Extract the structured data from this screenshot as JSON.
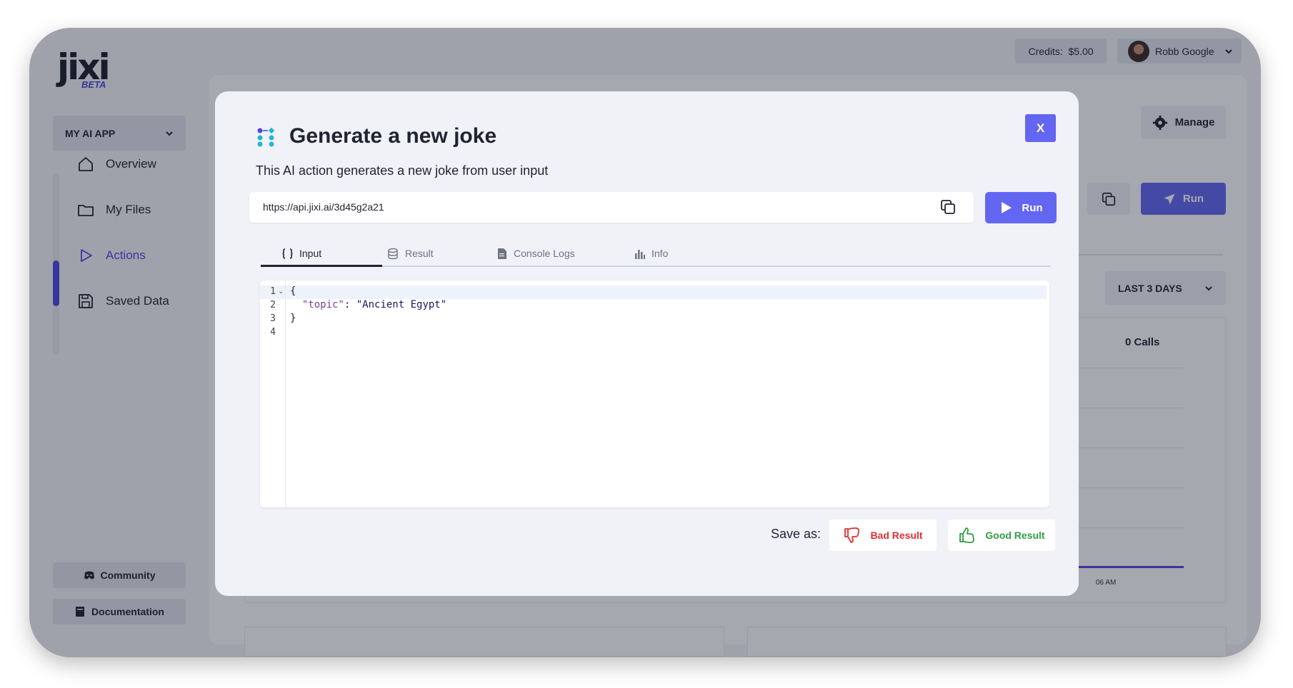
{
  "app": {
    "logo": "jixi",
    "logo_badge": "BETA",
    "app_select": "MY AI APP"
  },
  "header": {
    "credits_label": "Credits:",
    "credits_value": "$5.00",
    "user_name": "Robb Google"
  },
  "sidebar": {
    "items": [
      {
        "label": "Overview",
        "icon": "home-icon"
      },
      {
        "label": "My Files",
        "icon": "folder-icon"
      },
      {
        "label": "Actions",
        "icon": "play-icon",
        "active": true
      },
      {
        "label": "Saved Data",
        "icon": "save-icon"
      }
    ],
    "community": "Community",
    "documentation": "Documentation"
  },
  "background": {
    "manage": "Manage",
    "run": "Run",
    "range": "LAST 3 DAYS",
    "calls": "0 Calls",
    "tick": "06 AM"
  },
  "modal": {
    "title": "Generate a new joke",
    "description": "This AI action generates a new joke from user input",
    "close": "X",
    "url": "https://api.jixi.ai/3d45g2a21",
    "run": "Run",
    "tabs": [
      {
        "label": "Input",
        "icon": "braces-icon",
        "active": true
      },
      {
        "label": "Result",
        "icon": "database-icon"
      },
      {
        "label": "Console Logs",
        "icon": "document-icon"
      },
      {
        "label": "Info",
        "icon": "bar-chart-icon"
      }
    ],
    "editor": {
      "line_numbers": [
        "1",
        "2",
        "3",
        "4"
      ],
      "lines": [
        "{",
        "  \"topic\": \"Ancient Egypt\"",
        "}",
        ""
      ]
    },
    "save_as": "Save as:",
    "bad_result": "Bad Result",
    "good_result": "Good Result"
  },
  "colors": {
    "accent": "#6366f1",
    "nav_active": "#4f46e5",
    "bad": "#e03131",
    "good": "#2f9e44"
  }
}
